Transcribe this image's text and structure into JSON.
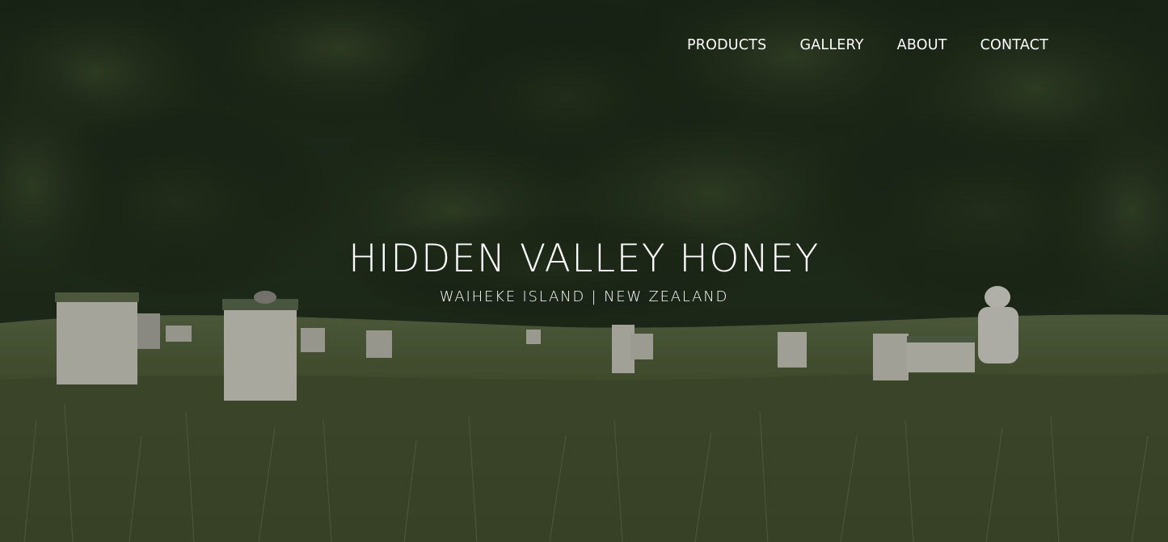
{
  "nav": {
    "items": [
      {
        "label": "PRODUCTS"
      },
      {
        "label": "GALLERY"
      },
      {
        "label": "ABOUT"
      },
      {
        "label": "CONTACT"
      }
    ]
  },
  "hero": {
    "title": "HIDDEN VALLEY HONEY",
    "subtitle": "WAIHEKE ISLAND | NEW ZEALAND"
  },
  "colors": {
    "text": "#ffffff",
    "forest_dark": "#1a2414",
    "grass": "#4f5a36"
  }
}
